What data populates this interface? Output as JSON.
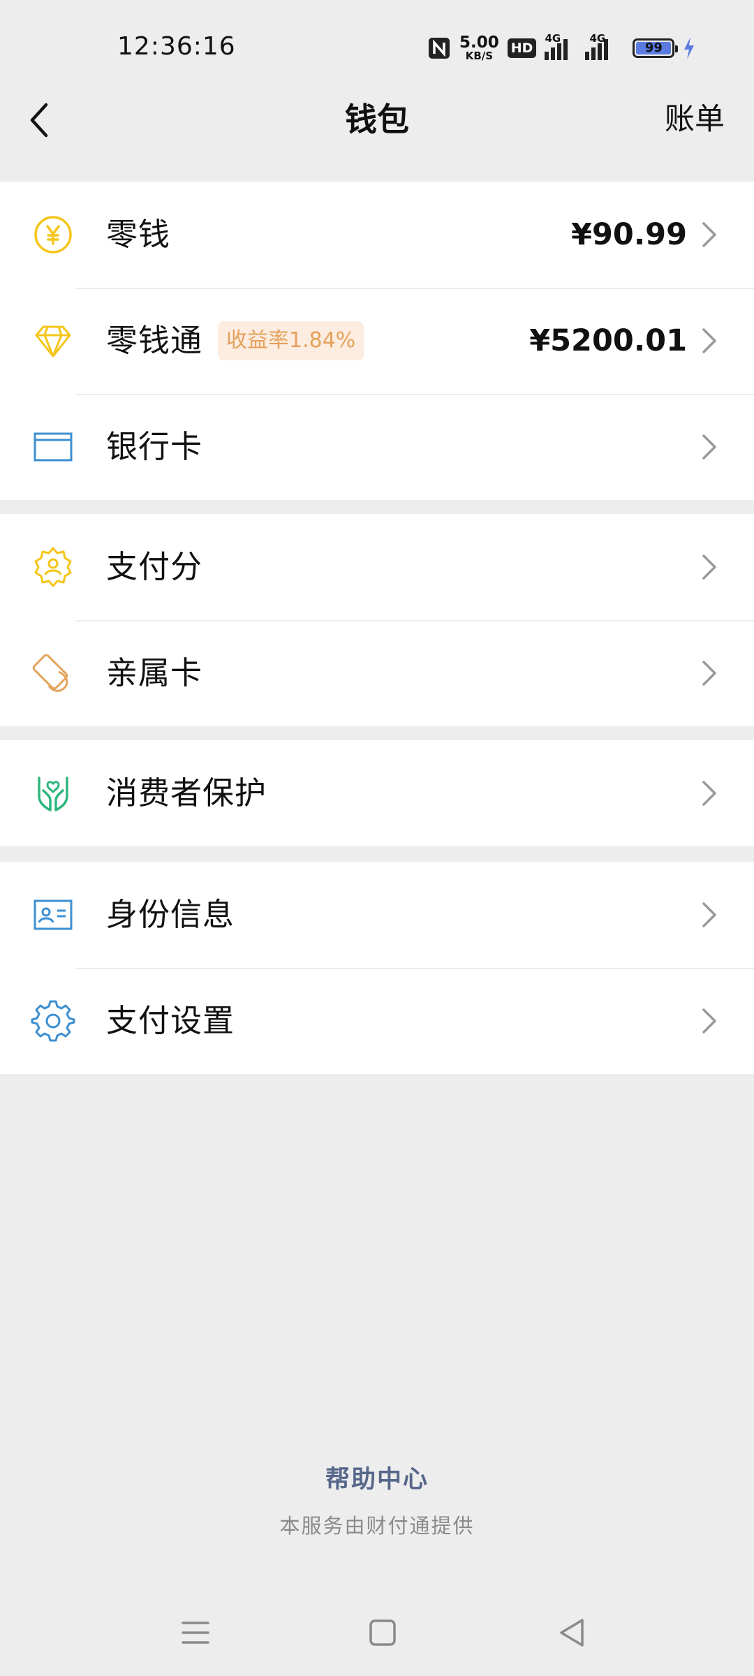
{
  "status_bar": {
    "time": "12:36:16",
    "net_speed_value": "5.00",
    "net_speed_unit": "KB/S",
    "hd_label": "HD",
    "signal1_label": "4G",
    "signal2_label": "4G",
    "battery_level": "99"
  },
  "nav": {
    "title": "钱包",
    "right_action": "账单"
  },
  "groups": [
    {
      "rows": [
        {
          "label": "零钱",
          "amount": "¥90.99",
          "icon": "yuan-coin-icon",
          "icon_color": "#f5c518"
        },
        {
          "label": "零钱通",
          "badge": "收益率1.84%",
          "amount": "¥5200.01",
          "icon": "diamond-icon",
          "icon_color": "#f5c518"
        },
        {
          "label": "银行卡",
          "icon": "bank-card-icon",
          "icon_color": "#3d8fd1"
        }
      ]
    },
    {
      "rows": [
        {
          "label": "支付分",
          "icon": "credit-score-icon",
          "icon_color": "#f5c518"
        },
        {
          "label": "亲属卡",
          "icon": "family-card-icon",
          "icon_color": "#e4a45c"
        }
      ]
    },
    {
      "rows": [
        {
          "label": "消费者保护",
          "icon": "hands-protect-icon",
          "icon_color": "#2cb67d"
        }
      ]
    },
    {
      "rows": [
        {
          "label": "身份信息",
          "icon": "id-card-icon",
          "icon_color": "#3d8fd1"
        },
        {
          "label": "支付设置",
          "icon": "gear-icon",
          "icon_color": "#3d8fd1"
        }
      ]
    }
  ],
  "footer": {
    "help_link": "帮助中心",
    "provider_text": "本服务由财付通提供"
  },
  "colors": {
    "background": "#ededed",
    "badge_bg": "#fdece0",
    "badge_text": "#e3a25c",
    "help_link": "#57678b"
  }
}
